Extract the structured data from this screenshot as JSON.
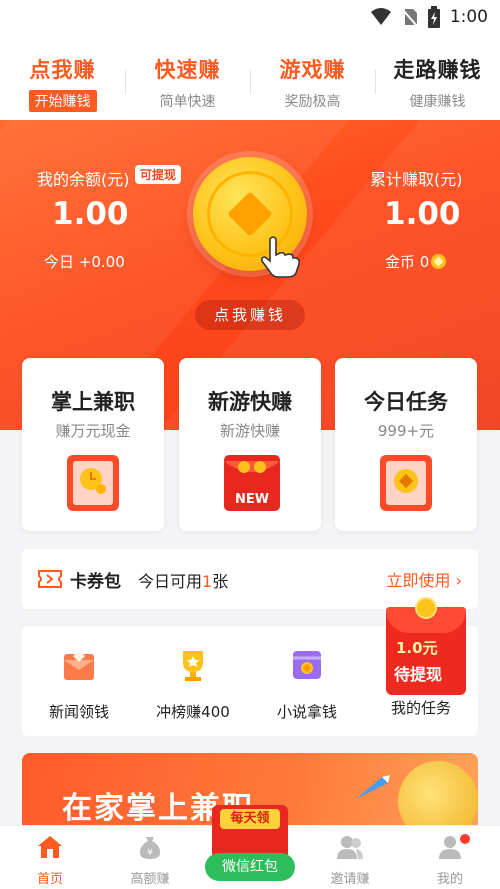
{
  "status_bar": {
    "time": "1:00"
  },
  "top_tabs": [
    {
      "title": "点我赚",
      "subtitle": "开始赚钱"
    },
    {
      "title": "快速赚",
      "subtitle": "简单快速"
    },
    {
      "title": "游戏赚",
      "subtitle": "奖励极高"
    },
    {
      "title": "走路赚钱",
      "subtitle": "健康赚钱"
    }
  ],
  "hero": {
    "balance_label": "我的余额(元)",
    "withdraw_tag": "可提现",
    "balance_value": "1.00",
    "today_label": "今日 +0.00",
    "total_label": "累计赚取(元)",
    "total_value": "1.00",
    "gold_label": "金币 0",
    "earn_button": "点我赚钱"
  },
  "cards": [
    {
      "title": "掌上兼职",
      "subtitle": "赚万元现金"
    },
    {
      "title": "新游快赚",
      "subtitle": "新游快赚",
      "badge": "NEW"
    },
    {
      "title": "今日任务",
      "subtitle": "999+元"
    }
  ],
  "coupon": {
    "name": "卡券包",
    "prefix": "今日可用",
    "count": "1",
    "suffix": "张",
    "action": "立即使用"
  },
  "functions": [
    {
      "label": "新闻领钱",
      "icon": "news-envelope-icon"
    },
    {
      "label": "冲榜赚400",
      "icon": "trophy-icon"
    },
    {
      "label": "小说拿钱",
      "icon": "book-icon"
    },
    {
      "label": "我的任务",
      "icon": "task-icon"
    }
  ],
  "red_packet": {
    "amount": "1.0元",
    "label": "待提现"
  },
  "banner": {
    "text": "在家掌上兼职"
  },
  "wechat_float": {
    "ribbon": "每天领",
    "button": "微信红包"
  },
  "bottom_nav": [
    {
      "label": "首页",
      "active": true
    },
    {
      "label": "高额赚"
    },
    {
      "label": ""
    },
    {
      "label": "邀请赚"
    },
    {
      "label": "我的"
    }
  ],
  "colors": {
    "accent": "#ff5a1f",
    "hero": "#ff4a1c",
    "wechat": "#2fbc5b"
  }
}
